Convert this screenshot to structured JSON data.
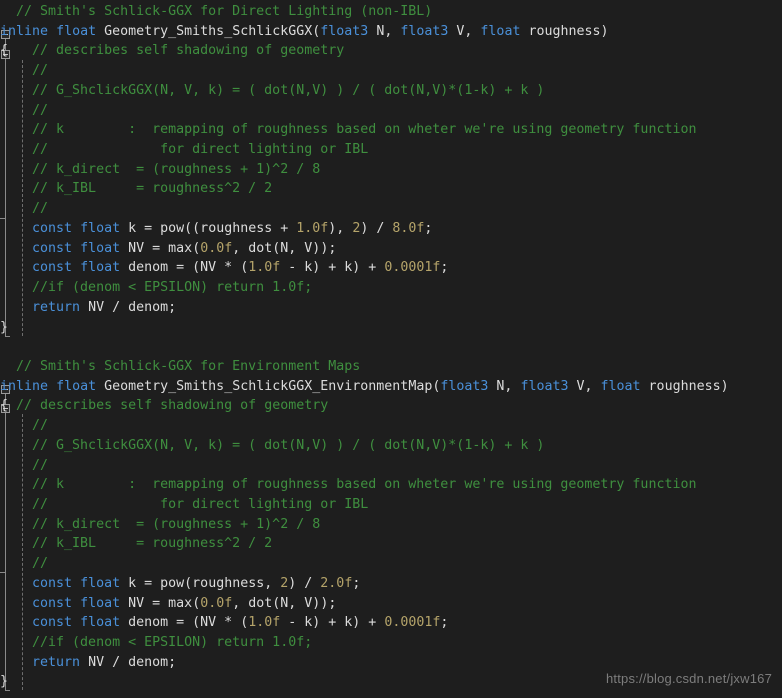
{
  "editor": {
    "background": "#1e1e1e",
    "default_text_color": "#dcdcdc",
    "comment_color": "#3f8f3f",
    "keyword_color": "#4a90d9",
    "number_color": "#b5a46a",
    "language": "hlsl",
    "line_count": 35
  },
  "watermark": {
    "text": "https://blog.csdn.net/jxw167"
  },
  "lines": [
    {
      "n": 1,
      "text": "  // Smith's Schlick-GGX for Direct Lighting (non-IBL)"
    },
    {
      "n": 2,
      "text": "inline float Geometry_Smiths_SchlickGGX(float3 N, float3 V, float roughness)"
    },
    {
      "n": 3,
      "text": "{   // describes self shadowing of geometry"
    },
    {
      "n": 4,
      "text": "    //"
    },
    {
      "n": 5,
      "text": "    // G_ShclickGGX(N, V, k) = ( dot(N,V) ) / ( dot(N,V)*(1-k) + k )"
    },
    {
      "n": 6,
      "text": "    //"
    },
    {
      "n": 7,
      "text": "    // k        :  remapping of roughness based on wheter we're using geometry function"
    },
    {
      "n": 8,
      "text": "    //              for direct lighting or IBL"
    },
    {
      "n": 9,
      "text": "    // k_direct  = (roughness + 1)^2 / 8"
    },
    {
      "n": 10,
      "text": "    // k_IBL     = roughness^2 / 2"
    },
    {
      "n": 11,
      "text": "    //"
    },
    {
      "n": 12,
      "text": "    const float k = pow((roughness + 1.0f), 2) / 8.0f;"
    },
    {
      "n": 13,
      "text": "    const float NV = max(0.0f, dot(N, V));"
    },
    {
      "n": 14,
      "text": "    const float denom = (NV * (1.0f - k) + k) + 0.0001f;"
    },
    {
      "n": 15,
      "text": "    //if (denom < EPSILON) return 1.0f;"
    },
    {
      "n": 16,
      "text": "    return NV / denom;"
    },
    {
      "n": 17,
      "text": "}"
    },
    {
      "n": 18,
      "text": ""
    },
    {
      "n": 19,
      "text": "  // Smith's Schlick-GGX for Environment Maps"
    },
    {
      "n": 20,
      "text": "inline float Geometry_Smiths_SchlickGGX_EnvironmentMap(float3 N, float3 V, float roughness)"
    },
    {
      "n": 21,
      "text": "{ // describes self shadowing of geometry"
    },
    {
      "n": 22,
      "text": "    //"
    },
    {
      "n": 23,
      "text": "    // G_ShclickGGX(N, V, k) = ( dot(N,V) ) / ( dot(N,V)*(1-k) + k )"
    },
    {
      "n": 24,
      "text": "    //"
    },
    {
      "n": 25,
      "text": "    // k        :  remapping of roughness based on wheter we're using geometry function"
    },
    {
      "n": 26,
      "text": "    //              for direct lighting or IBL"
    },
    {
      "n": 27,
      "text": "    // k_direct  = (roughness + 1)^2 / 8"
    },
    {
      "n": 28,
      "text": "    // k_IBL     = roughness^2 / 2"
    },
    {
      "n": 29,
      "text": "    //"
    },
    {
      "n": 30,
      "text": "    const float k = pow(roughness, 2) / 2.0f;"
    },
    {
      "n": 31,
      "text": "    const float NV = max(0.0f, dot(N, V));"
    },
    {
      "n": 32,
      "text": "    const float denom = (NV * (1.0f - k) + k) + 0.0001f;"
    },
    {
      "n": 33,
      "text": "    //if (denom < EPSILON) return 1.0f;"
    },
    {
      "n": 34,
      "text": "    return NV / denom;"
    },
    {
      "n": 35,
      "text": "}"
    }
  ],
  "tokens": [
    [
      {
        "t": "  // Smith's Schlick-GGX for Direct Lighting (non-IBL)",
        "c": "cm"
      }
    ],
    [
      {
        "t": "inline",
        "c": "kw"
      },
      {
        "t": " ",
        "c": "pn"
      },
      {
        "t": "float",
        "c": "ty"
      },
      {
        "t": " ",
        "c": "pn"
      },
      {
        "t": "Geometry_Smiths_SchlickGGX",
        "c": "id"
      },
      {
        "t": "(",
        "c": "pn"
      },
      {
        "t": "float3",
        "c": "ty"
      },
      {
        "t": " N, ",
        "c": "id"
      },
      {
        "t": "float3",
        "c": "ty"
      },
      {
        "t": " V, ",
        "c": "id"
      },
      {
        "t": "float",
        "c": "ty"
      },
      {
        "t": " roughness",
        "c": "id"
      },
      {
        "t": ")",
        "c": "pn"
      }
    ],
    [
      {
        "t": "{",
        "c": "pn"
      },
      {
        "t": "   // describes self shadowing of geometry",
        "c": "cm"
      }
    ],
    [
      {
        "t": "    //",
        "c": "cm"
      }
    ],
    [
      {
        "t": "    // G_ShclickGGX(N, V, k) = ( dot(N,V) ) / ( dot(N,V)*(1-k) + k )",
        "c": "cm"
      }
    ],
    [
      {
        "t": "    //",
        "c": "cm"
      }
    ],
    [
      {
        "t": "    // k        :  remapping of roughness based on wheter we're using geometry function",
        "c": "cm"
      }
    ],
    [
      {
        "t": "    //              for direct lighting or IBL",
        "c": "cm"
      }
    ],
    [
      {
        "t": "    // k_direct  = (roughness + 1)^2 / 8",
        "c": "cm"
      }
    ],
    [
      {
        "t": "    // k_IBL     = roughness^2 / 2",
        "c": "cm"
      }
    ],
    [
      {
        "t": "    //",
        "c": "cm"
      }
    ],
    [
      {
        "t": "    ",
        "c": "pn"
      },
      {
        "t": "const",
        "c": "kw"
      },
      {
        "t": " ",
        "c": "pn"
      },
      {
        "t": "float",
        "c": "ty"
      },
      {
        "t": " k = ",
        "c": "id"
      },
      {
        "t": "pow",
        "c": "id"
      },
      {
        "t": "((roughness + ",
        "c": "id"
      },
      {
        "t": "1.0f",
        "c": "nm"
      },
      {
        "t": "), ",
        "c": "id"
      },
      {
        "t": "2",
        "c": "nm"
      },
      {
        "t": ") / ",
        "c": "id"
      },
      {
        "t": "8.0f",
        "c": "nm"
      },
      {
        "t": ";",
        "c": "id"
      }
    ],
    [
      {
        "t": "    ",
        "c": "pn"
      },
      {
        "t": "const",
        "c": "kw"
      },
      {
        "t": " ",
        "c": "pn"
      },
      {
        "t": "float",
        "c": "ty"
      },
      {
        "t": " NV = ",
        "c": "id"
      },
      {
        "t": "max",
        "c": "id"
      },
      {
        "t": "(",
        "c": "id"
      },
      {
        "t": "0.0f",
        "c": "nm"
      },
      {
        "t": ", ",
        "c": "id"
      },
      {
        "t": "dot",
        "c": "id"
      },
      {
        "t": "(N, V));",
        "c": "id"
      }
    ],
    [
      {
        "t": "    ",
        "c": "pn"
      },
      {
        "t": "const",
        "c": "kw"
      },
      {
        "t": " ",
        "c": "pn"
      },
      {
        "t": "float",
        "c": "ty"
      },
      {
        "t": " denom = (NV * (",
        "c": "id"
      },
      {
        "t": "1.0f",
        "c": "nm"
      },
      {
        "t": " - k) + k) + ",
        "c": "id"
      },
      {
        "t": "0.0001f",
        "c": "nm"
      },
      {
        "t": ";",
        "c": "id"
      }
    ],
    [
      {
        "t": "    //if (denom < EPSILON) return 1.0f;",
        "c": "cm"
      }
    ],
    [
      {
        "t": "    ",
        "c": "pn"
      },
      {
        "t": "return",
        "c": "kw"
      },
      {
        "t": " NV / denom;",
        "c": "id"
      }
    ],
    [
      {
        "t": "}",
        "c": "pn"
      }
    ],
    [
      {
        "t": "",
        "c": "pn"
      }
    ],
    [
      {
        "t": "  // Smith's Schlick-GGX for Environment Maps",
        "c": "cm"
      }
    ],
    [
      {
        "t": "inline",
        "c": "kw"
      },
      {
        "t": " ",
        "c": "pn"
      },
      {
        "t": "float",
        "c": "ty"
      },
      {
        "t": " ",
        "c": "pn"
      },
      {
        "t": "Geometry_Smiths_SchlickGGX_EnvironmentMap",
        "c": "id"
      },
      {
        "t": "(",
        "c": "pn"
      },
      {
        "t": "float3",
        "c": "ty"
      },
      {
        "t": " N, ",
        "c": "id"
      },
      {
        "t": "float3",
        "c": "ty"
      },
      {
        "t": " V, ",
        "c": "id"
      },
      {
        "t": "float",
        "c": "ty"
      },
      {
        "t": " roughness",
        "c": "id"
      },
      {
        "t": ")",
        "c": "pn"
      }
    ],
    [
      {
        "t": "{",
        "c": "pn"
      },
      {
        "t": " // describes self shadowing of geometry",
        "c": "cm"
      }
    ],
    [
      {
        "t": "    //",
        "c": "cm"
      }
    ],
    [
      {
        "t": "    // G_ShclickGGX(N, V, k) = ( dot(N,V) ) / ( dot(N,V)*(1-k) + k )",
        "c": "cm"
      }
    ],
    [
      {
        "t": "    //",
        "c": "cm"
      }
    ],
    [
      {
        "t": "    // k        :  remapping of roughness based on wheter we're using geometry function",
        "c": "cm"
      }
    ],
    [
      {
        "t": "    //              for direct lighting or IBL",
        "c": "cm"
      }
    ],
    [
      {
        "t": "    // k_direct  = (roughness + 1)^2 / 8",
        "c": "cm"
      }
    ],
    [
      {
        "t": "    // k_IBL     = roughness^2 / 2",
        "c": "cm"
      }
    ],
    [
      {
        "t": "    //",
        "c": "cm"
      }
    ],
    [
      {
        "t": "    ",
        "c": "pn"
      },
      {
        "t": "const",
        "c": "kw"
      },
      {
        "t": " ",
        "c": "pn"
      },
      {
        "t": "float",
        "c": "ty"
      },
      {
        "t": " k = ",
        "c": "id"
      },
      {
        "t": "pow",
        "c": "id"
      },
      {
        "t": "(roughness, ",
        "c": "id"
      },
      {
        "t": "2",
        "c": "nm"
      },
      {
        "t": ") / ",
        "c": "id"
      },
      {
        "t": "2.0f",
        "c": "nm"
      },
      {
        "t": ";",
        "c": "id"
      }
    ],
    [
      {
        "t": "    ",
        "c": "pn"
      },
      {
        "t": "const",
        "c": "kw"
      },
      {
        "t": " ",
        "c": "pn"
      },
      {
        "t": "float",
        "c": "ty"
      },
      {
        "t": " NV = ",
        "c": "id"
      },
      {
        "t": "max",
        "c": "id"
      },
      {
        "t": "(",
        "c": "id"
      },
      {
        "t": "0.0f",
        "c": "nm"
      },
      {
        "t": ", ",
        "c": "id"
      },
      {
        "t": "dot",
        "c": "id"
      },
      {
        "t": "(N, V));",
        "c": "id"
      }
    ],
    [
      {
        "t": "    ",
        "c": "pn"
      },
      {
        "t": "const",
        "c": "kw"
      },
      {
        "t": " ",
        "c": "pn"
      },
      {
        "t": "float",
        "c": "ty"
      },
      {
        "t": " denom = (NV * (",
        "c": "id"
      },
      {
        "t": "1.0f",
        "c": "nm"
      },
      {
        "t": " - k) + k) + ",
        "c": "id"
      },
      {
        "t": "0.0001f",
        "c": "nm"
      },
      {
        "t": ";",
        "c": "id"
      }
    ],
    [
      {
        "t": "    //if (denom < EPSILON) return 1.0f;",
        "c": "cm"
      }
    ],
    [
      {
        "t": "    ",
        "c": "pn"
      },
      {
        "t": "return",
        "c": "kw"
      },
      {
        "t": " NV / denom;",
        "c": "id"
      }
    ],
    [
      {
        "t": "}",
        "c": "pn"
      }
    ]
  ],
  "fold_regions": [
    {
      "name": "function-1-signature-fold",
      "line": 2
    },
    {
      "name": "function-1-body-fold",
      "line": 3
    },
    {
      "name": "function-2-signature-fold",
      "line": 20
    },
    {
      "name": "function-2-body-fold",
      "line": 21
    }
  ]
}
